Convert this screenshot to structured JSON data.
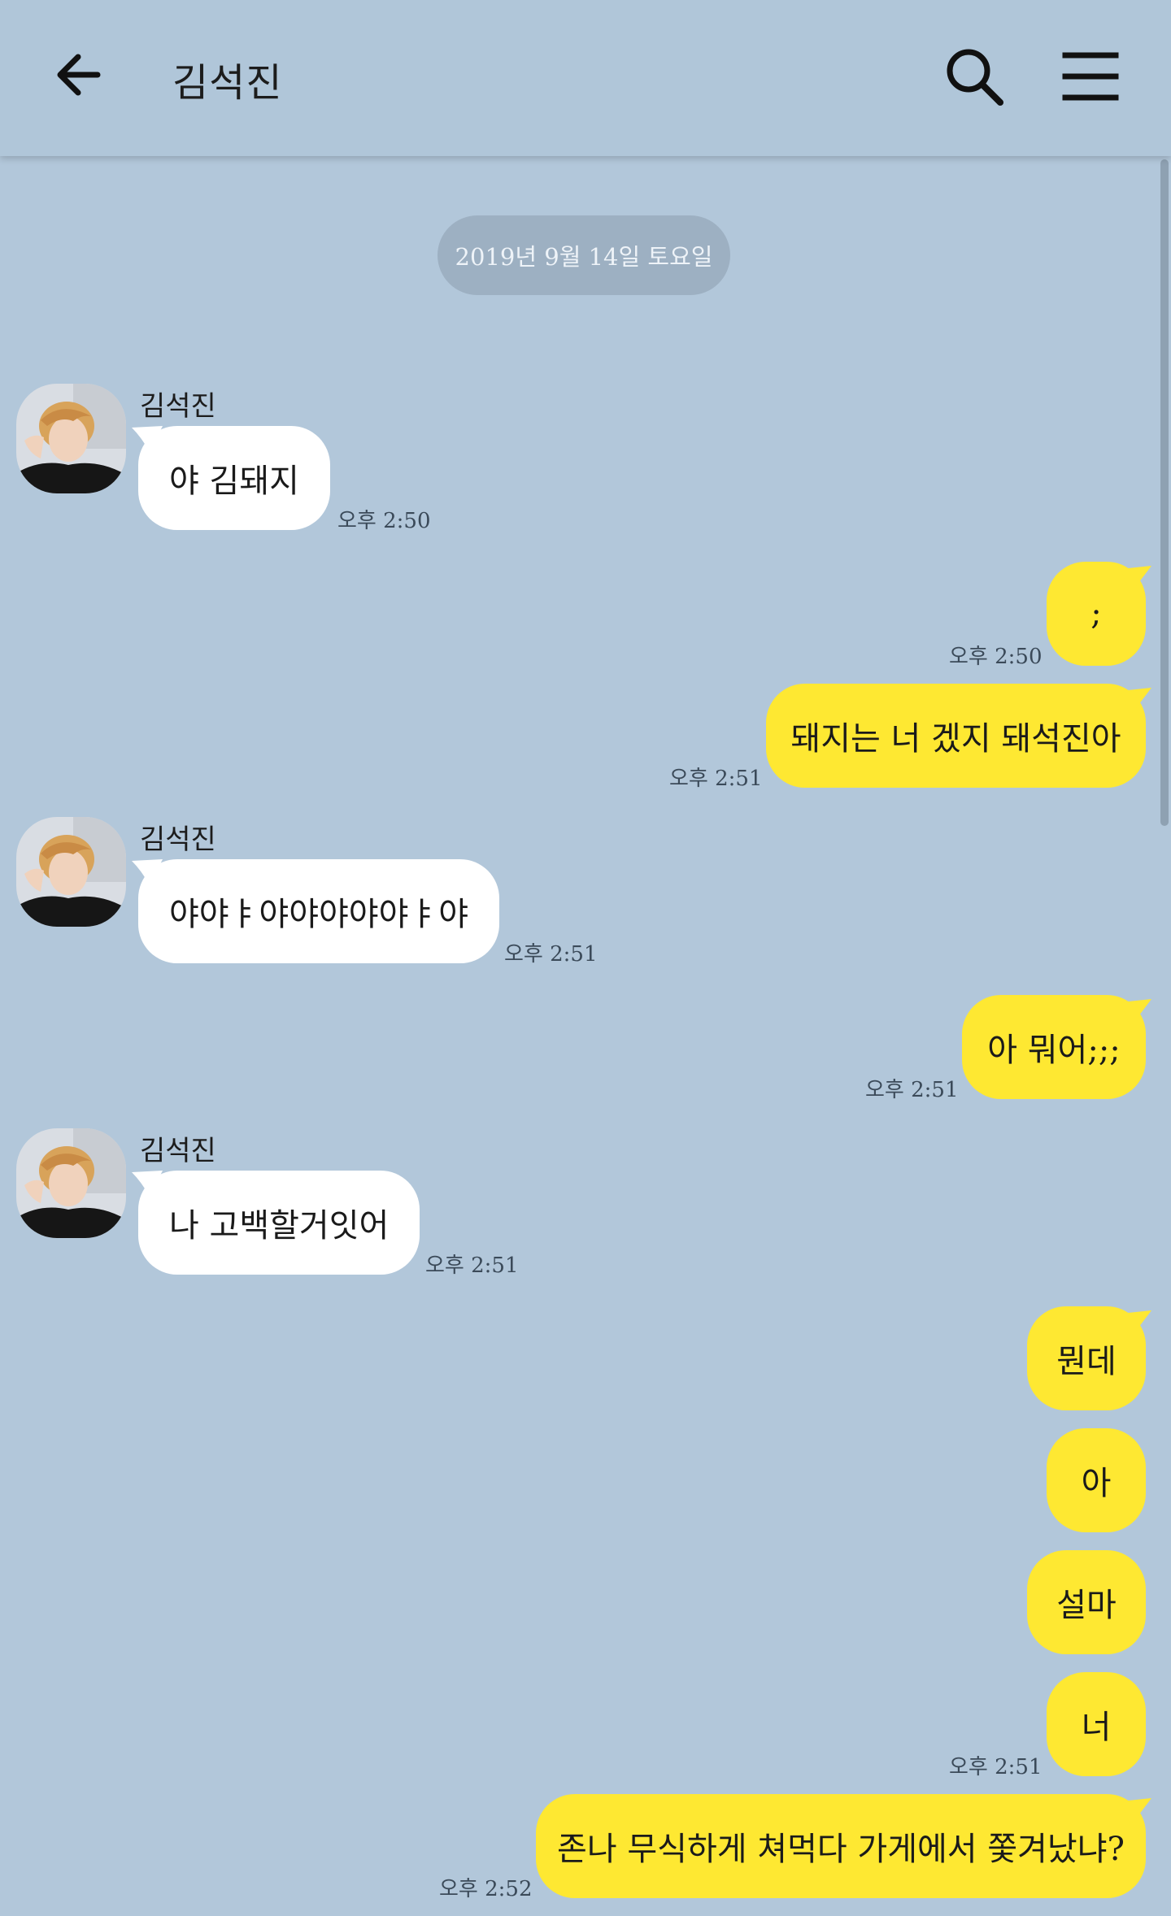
{
  "header": {
    "title": "김석진",
    "icons": {
      "back": "arrow-left-icon",
      "search": "search-icon",
      "menu": "menu-icon"
    }
  },
  "date_divider": "2019년 9월 14일 토요일",
  "colors": {
    "background": "#b2c7da",
    "incoming_bubble": "#ffffff",
    "outgoing_bubble": "#fee832",
    "date_pill": "#9db0c2"
  },
  "messages": [
    {
      "direction": "in",
      "sender": "김석진",
      "text": "야 김돼지",
      "time": "오후 2:50"
    },
    {
      "direction": "out",
      "text": ";",
      "time": "오후 2:50"
    },
    {
      "direction": "out",
      "text": "돼지는 너 겠지 돼석진아",
      "time": "오후 2:51"
    },
    {
      "direction": "in",
      "sender": "김석진",
      "text": "야야ㅑ야야야야야ㅑ야",
      "time": "오후 2:51"
    },
    {
      "direction": "out",
      "text": "아 뭐어;;;",
      "time": "오후 2:51"
    },
    {
      "direction": "in",
      "sender": "김석진",
      "text": "나 고백할거잇어",
      "time": "오후 2:51"
    },
    {
      "direction": "out",
      "text": "뭔데",
      "time": ""
    },
    {
      "direction": "out",
      "text": "아",
      "time": ""
    },
    {
      "direction": "out",
      "text": "설마",
      "time": ""
    },
    {
      "direction": "out",
      "text": "너",
      "time": "오후 2:51"
    },
    {
      "direction": "out",
      "text": "존나 무식하게 쳐먹다 가게에서 쫓겨났냐?",
      "time": "오후 2:52"
    }
  ]
}
